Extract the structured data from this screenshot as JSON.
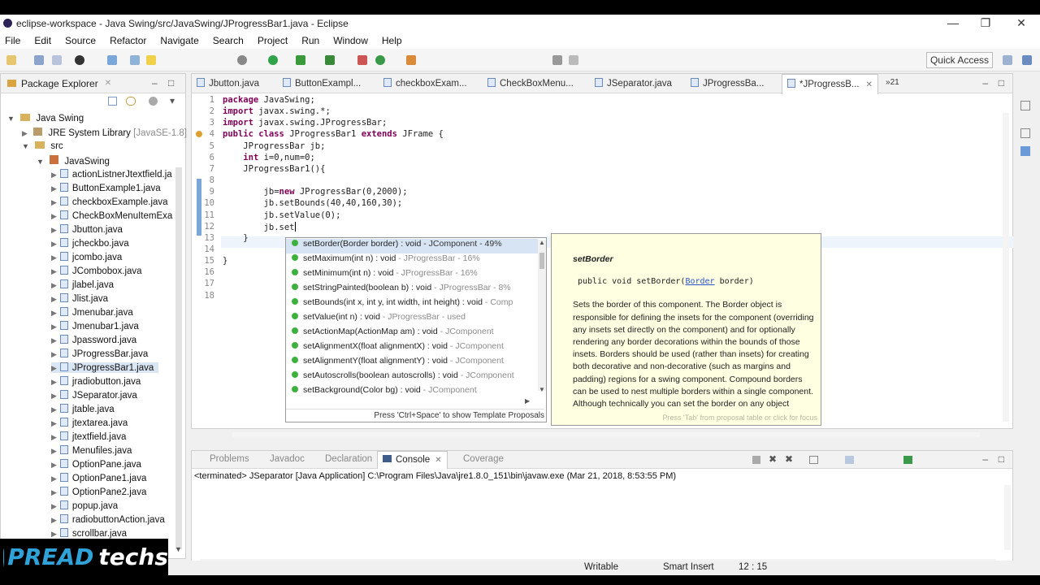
{
  "window": {
    "title": "eclipse-workspace - Java Swing/src/JavaSwing/JProgressBar1.java - Eclipse"
  },
  "menu": [
    "File",
    "Edit",
    "Source",
    "Refactor",
    "Navigate",
    "Search",
    "Project",
    "Run",
    "Window",
    "Help"
  ],
  "toolbar": {
    "quick_access": "Quick Access"
  },
  "package_explorer": {
    "title": "Package Explorer",
    "project": "Java Swing",
    "jre": "JRE System Library",
    "jre_version": "[JavaSE-1.8]",
    "src": "src",
    "package": "JavaSwing",
    "files": [
      "actionListnerJtextfield.ja",
      "ButtonExample1.java",
      "checkboxExample.java",
      "CheckBoxMenuItemExa",
      "Jbutton.java",
      "jcheckbo.java",
      "jcombo.java",
      "JCombobox.java",
      "jlabel.java",
      "Jlist.java",
      "Jmenubar.java",
      "Jmenubar1.java",
      "Jpassword.java",
      "JProgressBar.java",
      "JProgressBar1.java",
      "jradiobutton.java",
      "JSeparator.java",
      "jtable.java",
      "jtextarea.java",
      "jtextfield.java",
      "Menufiles.java",
      "OptionPane.java",
      "OptionPane1.java",
      "OptionPane2.java",
      "popup.java",
      "radiobuttonAction.java",
      "scrollbar.java"
    ],
    "selected_file": "JProgressBar1.java"
  },
  "editor_tabs": [
    "Jbutton.java",
    "ButtonExampl...",
    "checkboxExam...",
    "CheckBoxMenu...",
    "JSeparator.java",
    "JProgressBa...",
    "*JProgressB...",
    "21"
  ],
  "code": [
    "package JavaSwing;",
    "import javax.swing.*;",
    "import javax.swing.JProgressBar;",
    "public class JProgressBar1 extends JFrame {",
    "    JProgressBar jb;",
    "    int i=0,num=0;",
    "    JProgressBar1(){",
    "",
    "        jb=new JProgressBar(0,2000);",
    "        jb.setBounds(40,40,160,30);",
    "        jb.setValue(0);",
    "        jb.set",
    "    }",
    "",
    "}",
    "",
    "",
    ""
  ],
  "proposals": [
    {
      "name": "setBorder(Border border) : void",
      "detail": " - JComponent - 49%"
    },
    {
      "name": "setMaximum(int n) : void",
      "detail": " - JProgressBar - 16%"
    },
    {
      "name": "setMinimum(int n) : void",
      "detail": " - JProgressBar - 16%"
    },
    {
      "name": "setStringPainted(boolean b) : void",
      "detail": " - JProgressBar - 8%"
    },
    {
      "name": "setBounds(int x, int y, int width, int height) : void",
      "detail": " - Comp"
    },
    {
      "name": "setValue(int n) : void",
      "detail": " - JProgressBar - used"
    },
    {
      "name": "setActionMap(ActionMap am) : void",
      "detail": " - JComponent"
    },
    {
      "name": "setAlignmentX(float alignmentX) : void",
      "detail": " - JComponent"
    },
    {
      "name": "setAlignmentY(float alignmentY) : void",
      "detail": " - JComponent"
    },
    {
      "name": "setAutoscrolls(boolean autoscrolls) : void",
      "detail": " - JComponent"
    },
    {
      "name": "setBackground(Color bg) : void",
      "detail": " - JComponent"
    }
  ],
  "proposal_hint": "Press 'Ctrl+Space' to show Template Proposals",
  "doc": {
    "heading": "setBorder",
    "sig_pre": "public void setBorder(",
    "sig_link": "Border",
    "sig_post": " border)",
    "body": "Sets the border of this component. The Border object is responsible for defining the insets for the component (overriding any insets set directly on the component) and for optionally rendering any border decorations within the bounds of those insets. Borders should be used (rather than insets) for creating both decorative and non-decorative (such as margins and padding) regions for a swing component. Compound borders can be used to nest multiple borders within a single component.",
    "tail": "Although technically you can set the border on any object",
    "footer": "Press 'Tab' from proposal table or click for focus"
  },
  "console": {
    "tabs": [
      "Problems",
      "Javadoc",
      "Declaration",
      "Console",
      "Coverage"
    ],
    "active_tab": "Console",
    "output": "<terminated> JSeparator [Java Application] C:\\Program Files\\Java\\jre1.8.0_151\\bin\\javaw.exe (Mar 21, 2018, 8:53:55 PM)"
  },
  "status": {
    "writable": "Writable",
    "insert": "Smart Insert",
    "position": "12 : 15"
  },
  "watermark": {
    "text1": "PREAD",
    "text2": "techs"
  },
  "colors": {
    "accent": "#2fa3d8",
    "selection": "#d7e4f4",
    "keyword": "#7f0055"
  }
}
